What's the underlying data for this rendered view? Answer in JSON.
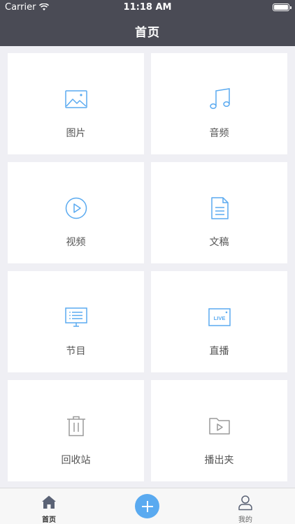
{
  "status_bar": {
    "carrier": "Carrier",
    "time": "11:18 AM",
    "battery_level": 1.0
  },
  "nav": {
    "title": "首页"
  },
  "tiles": [
    {
      "label": "图片",
      "icon": "image-icon"
    },
    {
      "label": "音频",
      "icon": "music-note-icon"
    },
    {
      "label": "视频",
      "icon": "play-circle-icon"
    },
    {
      "label": "文稿",
      "icon": "document-icon"
    },
    {
      "label": "节目",
      "icon": "program-list-icon"
    },
    {
      "label": "直播",
      "icon": "live-icon"
    },
    {
      "label": "回收站",
      "icon": "trash-icon"
    },
    {
      "label": "播出夹",
      "icon": "video-folder-icon"
    }
  ],
  "live_badge": "LIVE",
  "tabbar": {
    "home_label": "首页",
    "mine_label": "我的"
  },
  "colors": {
    "nav_bg": "#4a4b55",
    "icon_blue": "#5aaaf0",
    "icon_gray": "#9a9a9a",
    "page_bg": "#efeff4"
  }
}
